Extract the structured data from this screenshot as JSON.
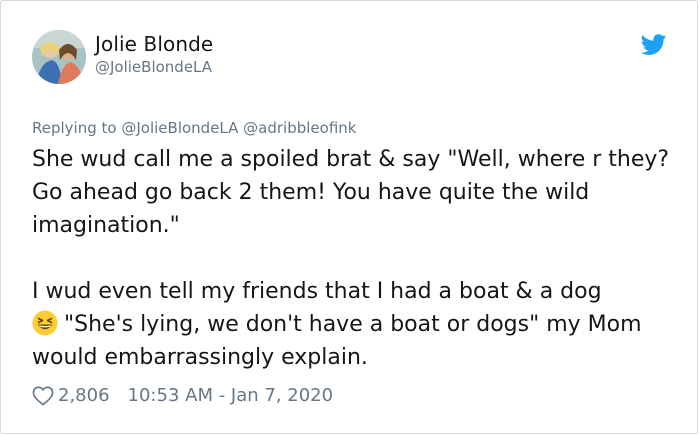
{
  "tweet": {
    "author": {
      "display_name": "Jolie Blonde",
      "handle": "@JolieBlondeLA"
    },
    "replying_prefix": "Replying to",
    "replying_to": [
      "@JolieBlondeLA",
      "@adribbleofink"
    ],
    "paragraph_1": "She wud call me a spoiled brat & say \"Well, where r they? Go ahead go back 2 them! You have quite the wild imagination.\"",
    "paragraph_2_before_emoji": "I wud even tell my friends that I had a boat & a dog",
    "paragraph_2_after_emoji": "\"She's lying, we don't have a boat or dogs\" my Mom would embarrassingly explain.",
    "likes": "2,806",
    "timestamp": "10:53 AM - Jan 7, 2020"
  },
  "icons": {
    "brand": "twitter-bird-icon",
    "like": "heart-icon",
    "emoji": "grinning-squinting-face-emoji"
  },
  "colors": {
    "twitter_blue": "#1da1f2",
    "text": "#14171a",
    "secondary_text": "#657786",
    "emoji_yellow": "#ffcc33"
  }
}
